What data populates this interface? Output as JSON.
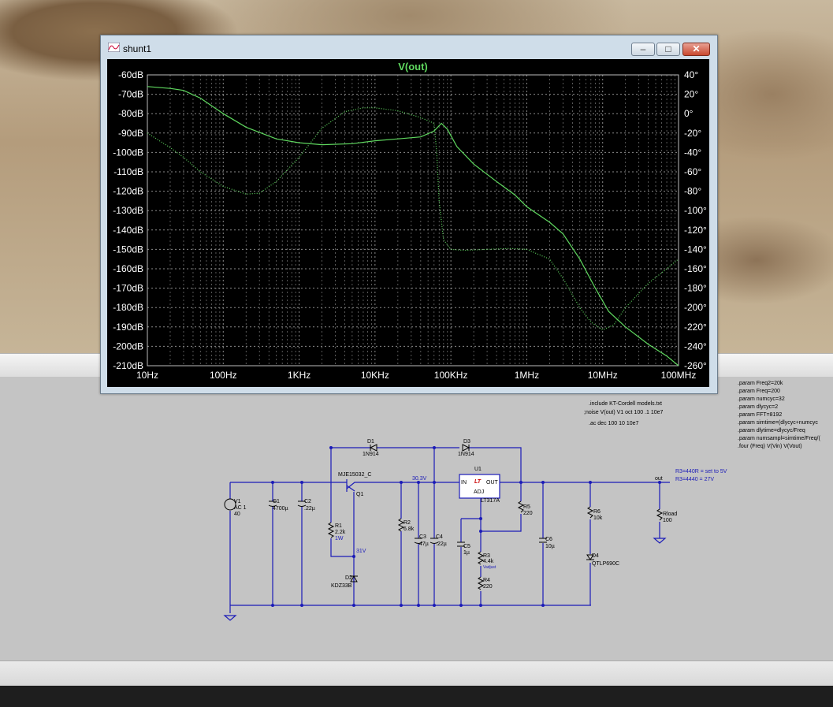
{
  "window": {
    "title": "shunt1",
    "icon": "ltspice-plot-icon",
    "buttons": [
      "minimize",
      "maximize",
      "close"
    ]
  },
  "chart_data": {
    "type": "line",
    "title": "V(out)",
    "x_scale": "log",
    "xlim": [
      10,
      100000000
    ],
    "x_ticks": [
      "10Hz",
      "100Hz",
      "1KHz",
      "10KHz",
      "100KHz",
      "1MHz",
      "10MHz",
      "100MHz"
    ],
    "y_left_ticks": [
      "-60dB",
      "-70dB",
      "-80dB",
      "-90dB",
      "-100dB",
      "-110dB",
      "-120dB",
      "-130dB",
      "-140dB",
      "-150dB",
      "-160dB",
      "-170dB",
      "-180dB",
      "-190dB",
      "-200dB",
      "-210dB"
    ],
    "y_right_ticks": [
      "40°",
      "20°",
      "0°",
      "-20°",
      "-40°",
      "-60°",
      "-80°",
      "-100°",
      "-120°",
      "-140°",
      "-160°",
      "-180°",
      "-200°",
      "-220°",
      "-240°",
      "-260°"
    ],
    "ylim_left": [
      -210,
      -60
    ],
    "ylim_right": [
      -260,
      40
    ],
    "grid": true,
    "trace_color": "#5fd85f",
    "series": [
      {
        "kind": "magnitude",
        "x": [
          10,
          20,
          30,
          50,
          100,
          200,
          500,
          1000,
          2000,
          5000,
          10000,
          20000,
          40000,
          60000,
          75000,
          90000,
          120000,
          200000,
          400000,
          700000,
          1000000,
          2000000,
          3000000,
          5000000,
          8000000,
          12000000,
          20000000,
          40000000,
          70000000,
          100000000
        ],
        "y": [
          -66,
          -67,
          -68,
          -72,
          -80,
          -87,
          -93,
          -95,
          -96,
          -95.5,
          -94,
          -93,
          -92,
          -89,
          -85,
          -88,
          -97,
          -106,
          -115,
          -122,
          -128,
          -136,
          -142,
          -155,
          -170,
          -182,
          -190,
          -199,
          -205,
          -210
        ]
      },
      {
        "kind": "phase",
        "x": [
          10,
          20,
          30,
          50,
          100,
          200,
          300,
          500,
          1000,
          2000,
          4000,
          7000,
          10000,
          20000,
          40000,
          60000,
          65000,
          70000,
          80000,
          100000,
          150000,
          300000,
          600000,
          1000000,
          2000000,
          3000000,
          5000000,
          7000000,
          10000000,
          14000000,
          20000000,
          40000000,
          70000000,
          100000000
        ],
        "y": [
          -20,
          -35,
          -45,
          -60,
          -75,
          -83,
          -82,
          -70,
          -45,
          -15,
          2,
          6,
          6,
          3,
          -4,
          -10,
          -40,
          -90,
          -130,
          -140,
          -141,
          -140,
          -139,
          -140,
          -150,
          -170,
          -200,
          -215,
          -223,
          -218,
          -200,
          -175,
          -160,
          -150
        ]
      }
    ]
  },
  "schematic": {
    "directives": [
      ".include KT-Cordell models.txt",
      ";noise V(out) V1 oct 100 .1 10e7",
      ".ac dec 100 10 10e7"
    ],
    "params": [
      ".param Freq2=20k",
      ".param Freq=200",
      ".param numcyc=32",
      ".param dlycyc=2",
      ".param FFT=8192",
      ".param simtime=(dlycyc+numcyc",
      ".param dlytime=dlycyc/Freq",
      ".param numsampl=simtime/Freq/(",
      ".four (Freq) V(Vin) V(Vout)"
    ],
    "notes": [
      "R3=440R  = set to 5V",
      "R3=4440  = 27V"
    ],
    "labels": {
      "V1": "V1",
      "V1_ac": "AC 1",
      "V1_val": "40",
      "C1": "C1",
      "C1_val": "4700µ",
      "C2": "C2",
      "C2_val": ".22µ",
      "Q1_model": "MJE15032_C",
      "Q1": "Q1",
      "R1": "R1",
      "R1_val": "2.2k",
      "R1_pwr": "1W",
      "V31": "31V",
      "D2": "D2",
      "D2_val": "KDZ33B",
      "D1": "D1",
      "D1_val": "1N914",
      "D3": "D3",
      "D3_val": "1N914",
      "V303": "30.3V",
      "R2": "R2",
      "R2_val": "6.8k",
      "C3": "C3",
      "C3_val": "47µ",
      "C4": "C4",
      "C4_val": ".22µ",
      "U1": "U1",
      "U1_in": "IN",
      "U1_out": "OUT",
      "U1_adj": "ADJ",
      "U1_logo": "LT",
      "U1_part": "LT317A",
      "C5": "C5",
      "C5_val": "1µ",
      "R3": "R3",
      "R3_val": "4.4k",
      "R3_note": "Vadjust",
      "R4": "R4",
      "R4_val": "220",
      "R5": "R5",
      "R5_val": "220",
      "C6": "C6",
      "C6_val": "10µ",
      "R6": "R6",
      "R6_val": "10k",
      "D4": "D4",
      "D4_val": "QTLP690C",
      "out": "out",
      "Rload": "Rload",
      "Rload_val": "100"
    }
  }
}
